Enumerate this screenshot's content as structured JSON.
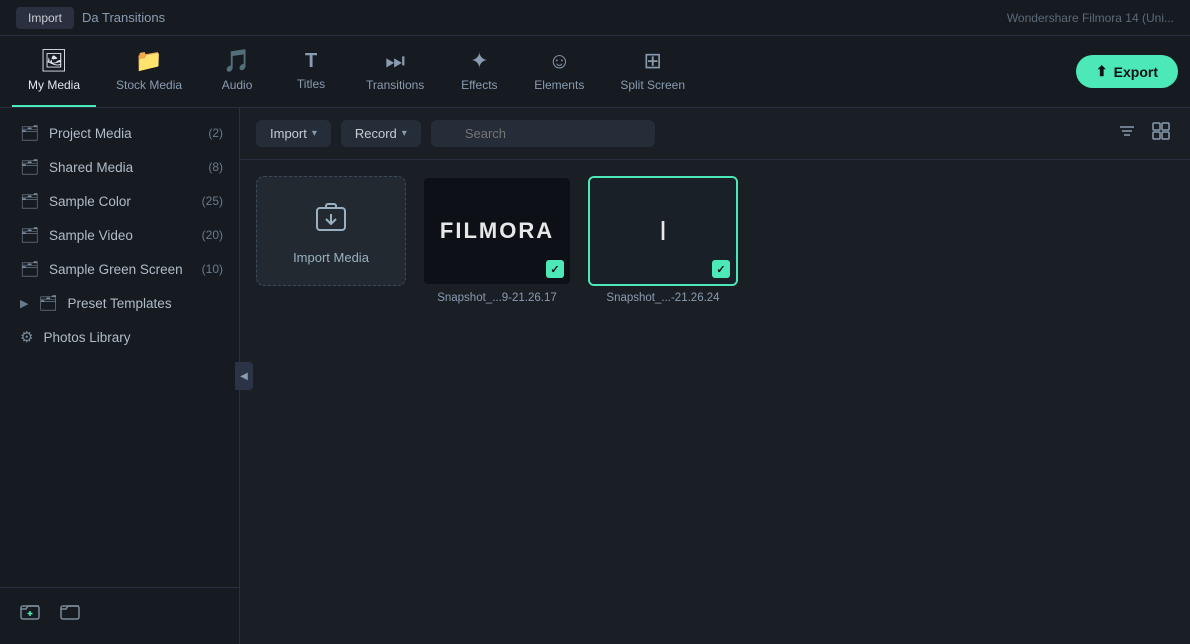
{
  "topbar": {
    "import_label": "Import",
    "title": "Da Transitions",
    "right_text": "Wondershare Filmora 14 (Uni..."
  },
  "tabs": [
    {
      "id": "my-media",
      "label": "My Media",
      "icon": "🖼",
      "active": true
    },
    {
      "id": "stock-media",
      "label": "Stock Media",
      "icon": "📁",
      "active": false
    },
    {
      "id": "audio",
      "label": "Audio",
      "icon": "🎵",
      "active": false
    },
    {
      "id": "titles",
      "label": "Titles",
      "icon": "T",
      "active": false
    },
    {
      "id": "transitions",
      "label": "Transitions",
      "icon": "⏭",
      "active": false
    },
    {
      "id": "effects",
      "label": "Effects",
      "icon": "✦",
      "active": false
    },
    {
      "id": "elements",
      "label": "Elements",
      "icon": "☺",
      "active": false
    },
    {
      "id": "split-screen",
      "label": "Split Screen",
      "icon": "⊞",
      "active": false
    }
  ],
  "export_button": "Export",
  "sidebar": {
    "items": [
      {
        "id": "project-media",
        "label": "Project Media",
        "count": "(2)"
      },
      {
        "id": "shared-media",
        "label": "Shared Media",
        "count": "(8)"
      },
      {
        "id": "sample-color",
        "label": "Sample Color",
        "count": "(25)"
      },
      {
        "id": "sample-video",
        "label": "Sample Video",
        "count": "(20)"
      },
      {
        "id": "sample-green-screen",
        "label": "Sample Green Screen",
        "count": "(10)"
      },
      {
        "id": "preset-templates",
        "label": "Preset Templates",
        "count": "",
        "expandable": true
      },
      {
        "id": "photos-library",
        "label": "Photos Library",
        "count": "",
        "special": true
      }
    ],
    "footer_buttons": [
      {
        "id": "new-folder",
        "icon": "⊞"
      },
      {
        "id": "folder-action",
        "icon": "⊟"
      }
    ]
  },
  "toolbar": {
    "import_label": "Import",
    "record_label": "Record",
    "search_placeholder": "Search"
  },
  "media_items": [
    {
      "id": "import-media",
      "type": "import",
      "label": "Import Media"
    },
    {
      "id": "snapshot-1",
      "type": "filmora",
      "label": "Snapshot_...9-21.26.17",
      "selected": false
    },
    {
      "id": "snapshot-2",
      "type": "plain",
      "label": "Snapshot_...-21.26.24",
      "selected": true
    }
  ]
}
